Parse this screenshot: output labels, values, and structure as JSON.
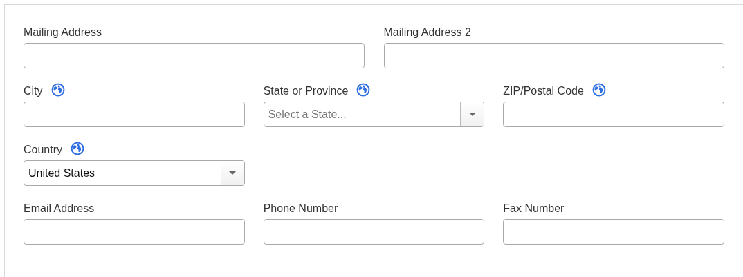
{
  "rows": [
    {
      "fields": [
        {
          "label": "Mailing Address",
          "kind": "text",
          "globe": false
        },
        {
          "label": "Mailing Address 2",
          "kind": "text",
          "globe": false
        }
      ]
    },
    {
      "fields": [
        {
          "label": "City",
          "kind": "text",
          "globe": true
        },
        {
          "label": "State or Province",
          "kind": "select",
          "globe": true,
          "placeholder": "Select a State..."
        },
        {
          "label": "ZIP/Postal Code",
          "kind": "text",
          "globe": true
        }
      ]
    },
    {
      "fields": [
        {
          "label": "Country",
          "kind": "select",
          "globe": true,
          "value": "United States"
        }
      ]
    },
    {
      "fields": [
        {
          "label": "Email Address",
          "kind": "text",
          "globe": false
        },
        {
          "label": "Phone Number",
          "kind": "text",
          "globe": false
        },
        {
          "label": "Fax Number",
          "kind": "text",
          "globe": false
        }
      ]
    }
  ]
}
